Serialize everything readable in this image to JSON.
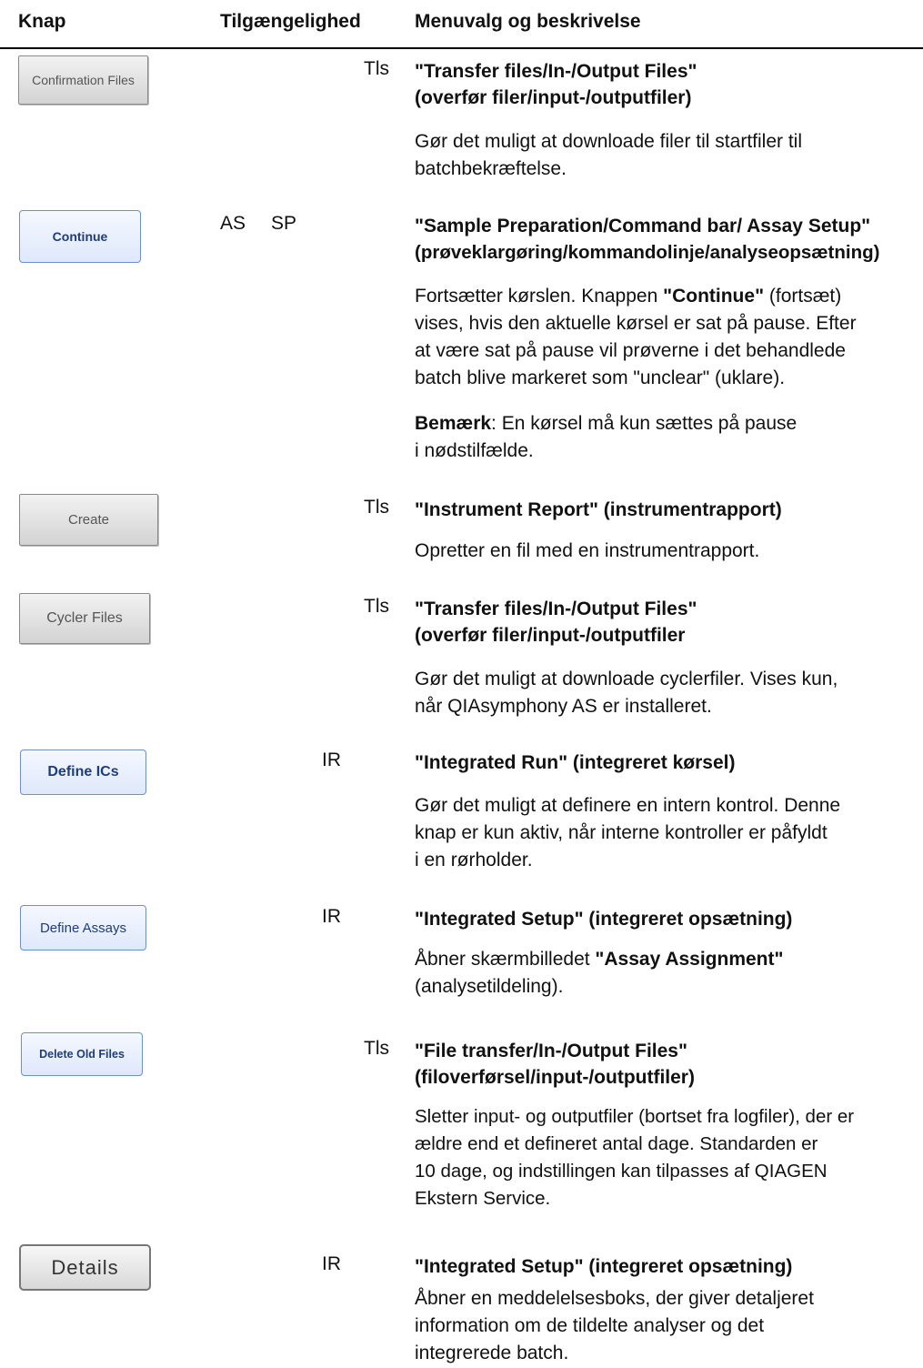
{
  "header": {
    "col_button": "Knap",
    "col_availability": "Tilgængelighed",
    "col_menu": "Menuvalg og beskrivelse"
  },
  "rows": [
    {
      "button": "Confirmation Files",
      "availability": "Tls",
      "title_line1": "\"Transfer files/In-/Output Files\"",
      "title_line2": "(overfør filer/input-/outputfiler)",
      "desc": [
        "Gør det muligt at downloade filer til startfiler til",
        "batchbekræftelse."
      ]
    },
    {
      "button": "Continue",
      "availability_as": "AS",
      "availability_sp": "SP",
      "title_line1": "\"Sample Preparation/Command bar/ Assay Setup\"",
      "title_line2": "(prøveklargøring/kommandolinje/analyseopsætning)",
      "desc_l1_pre": "Fortsætter kørslen. Knappen ",
      "desc_l1_bold": "\"Continue\"",
      "desc_l1_post": " (fortsæt)",
      "desc": [
        "vises, hvis den aktuelle kørsel er sat på pause. Efter",
        "at være sat på pause vil prøverne i det behandlede",
        "batch blive markeret som \"unclear\" (uklare)."
      ],
      "note_bold": "Bemærk",
      "note_l1": ": En kørsel må kun sættes på pause",
      "note_l2": "i nødstilfælde."
    },
    {
      "button": "Create",
      "availability": "Tls",
      "title_line1": "\"Instrument Report\" (instrumentrapport)",
      "desc": [
        "Opretter en fil med en instrumentrapport."
      ]
    },
    {
      "button": "Cycler Files",
      "availability": "Tls",
      "title_line1": "\"Transfer files/In-/Output Files\"",
      "title_line2": "(overfør filer/input-/outputfiler",
      "desc": [
        "Gør det muligt at downloade cyclerfiler. Vises kun,",
        "når QIAsymphony AS er installeret."
      ]
    },
    {
      "button": "Define ICs",
      "availability": "IR",
      "title_line1": "\"Integrated Run\" (integreret kørsel)",
      "desc": [
        "Gør det muligt at definere en intern kontrol. Denne",
        "knap er kun aktiv, når interne kontroller er påfyldt",
        "i en rørholder."
      ]
    },
    {
      "button": "Define Assays",
      "availability": "IR",
      "title_line1": "\"Integrated Setup\" (integreret opsætning)",
      "desc_l1_pre": "Åbner skærmbilledet ",
      "desc_l1_bold": "\"Assay Assignment\"",
      "desc": [
        "(analysetildeling)."
      ]
    },
    {
      "button": "Delete Old Files",
      "availability": "Tls",
      "title_line1": "\"File transfer/In-/Output Files\"",
      "title_line2": "(filoverførsel/input-/outputfiler)",
      "desc": [
        "Sletter input- og outputfiler (bortset fra logfiler), der er",
        "ældre end et defineret antal dage. Standarden er",
        "10 dage, og indstillingen kan tilpasses af QIAGEN",
        "Ekstern Service."
      ]
    },
    {
      "button": "Details",
      "availability": "IR",
      "title_line1": "\"Integrated Setup\" (integreret opsætning)",
      "desc": [
        "Åbner en meddelelsesboks, der giver detaljeret",
        "information om de tildelte analyser og det",
        "integrerede batch."
      ]
    }
  ]
}
